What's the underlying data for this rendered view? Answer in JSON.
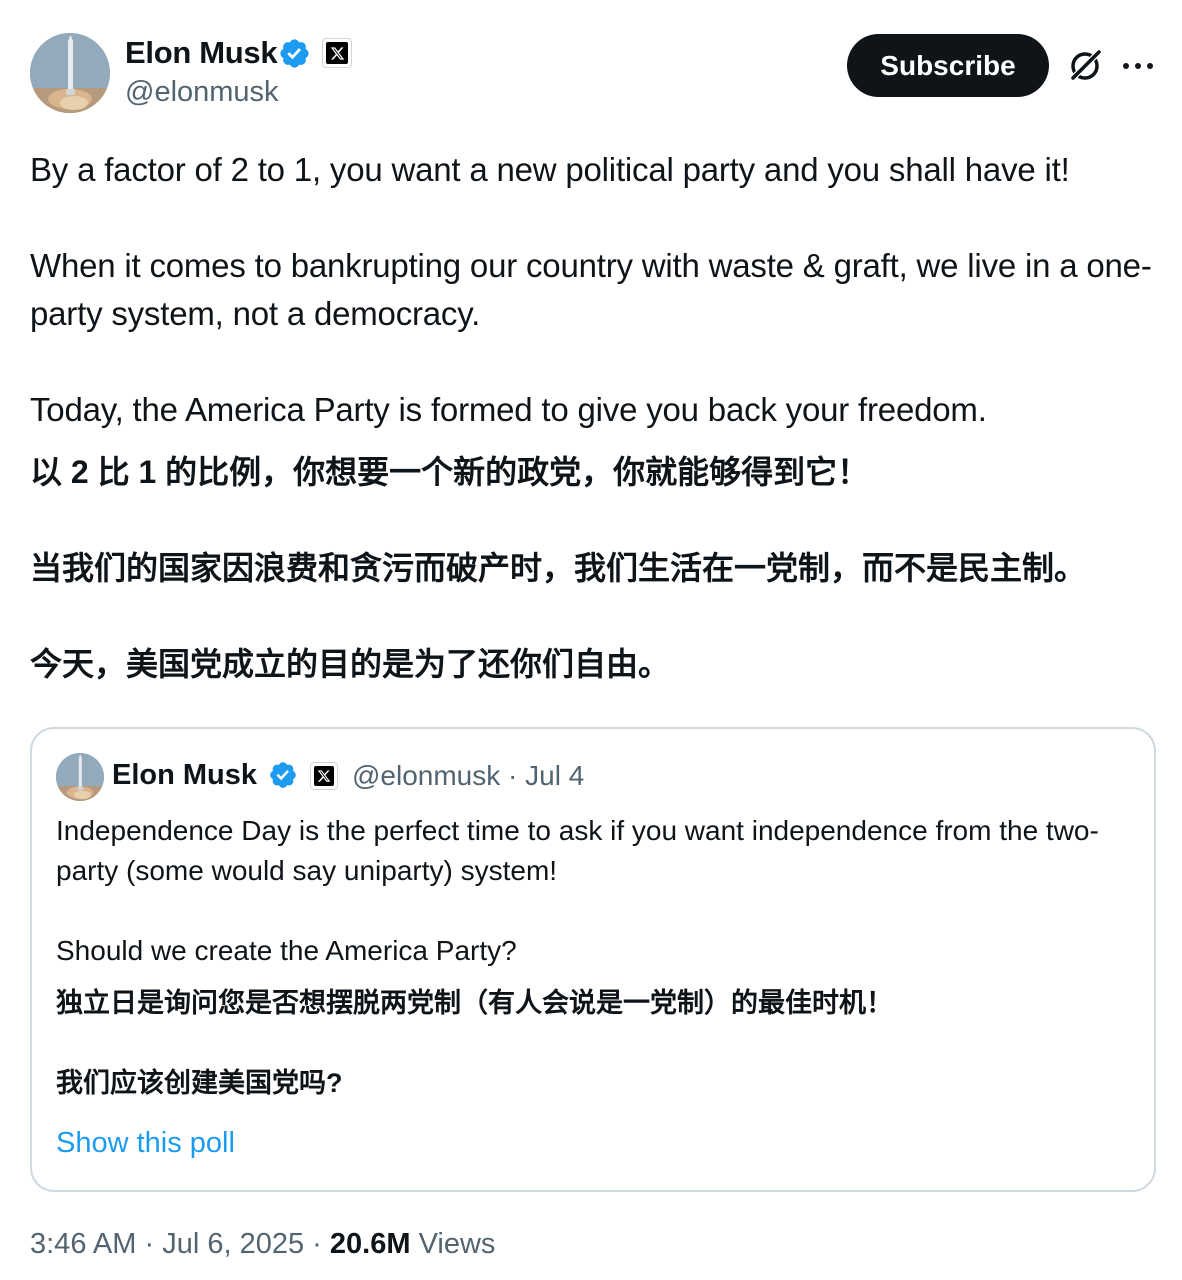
{
  "author": {
    "display_name": "Elon Musk",
    "handle": "@elonmusk",
    "verified_icon": "verified-badge-icon",
    "affiliation_icon": "x-logo-icon"
  },
  "header": {
    "subscribe_label": "Subscribe",
    "grok_icon": "grok-icon",
    "more_icon": "more-horizontal-icon"
  },
  "tweet": {
    "text": "By a factor of 2 to 1, you want a new political party and you shall have it!\n\nWhen it comes to bankrupting our country with waste & graft, we live in a one-party system, not a democracy.\n\nToday, the America Party is formed to give you back your freedom.",
    "translation": "以 2 比 1 的比例，你想要一个新的政党，你就能够得到它！\n\n当我们的国家因浪费和贪污而破产时，我们生活在一党制，而不是民主制。\n\n今天，美国党成立的目的是为了还你们自由。"
  },
  "quote": {
    "display_name": "Elon Musk",
    "handle": "@elonmusk",
    "separator": "·",
    "date": "Jul 4",
    "text": "Independence Day is the perfect time to ask if you want independence from the two-party (some would say uniparty) system!\n\nShould we create the America Party?",
    "translation": "独立日是询问您是否想摆脱两党制（有人会说是一党制）的最佳时机！\n\n我们应该创建美国党吗?",
    "poll_link": "Show this poll"
  },
  "footer": {
    "time": "3:46 AM",
    "separator": "·",
    "date": "Jul 6, 2025",
    "views_count": "20.6M",
    "views_label": "Views"
  },
  "colors": {
    "text_primary": "#0f1419",
    "text_secondary": "#536471",
    "link": "#1d9bf0",
    "verified": "#1d9bf0",
    "border": "#cfd9de"
  }
}
